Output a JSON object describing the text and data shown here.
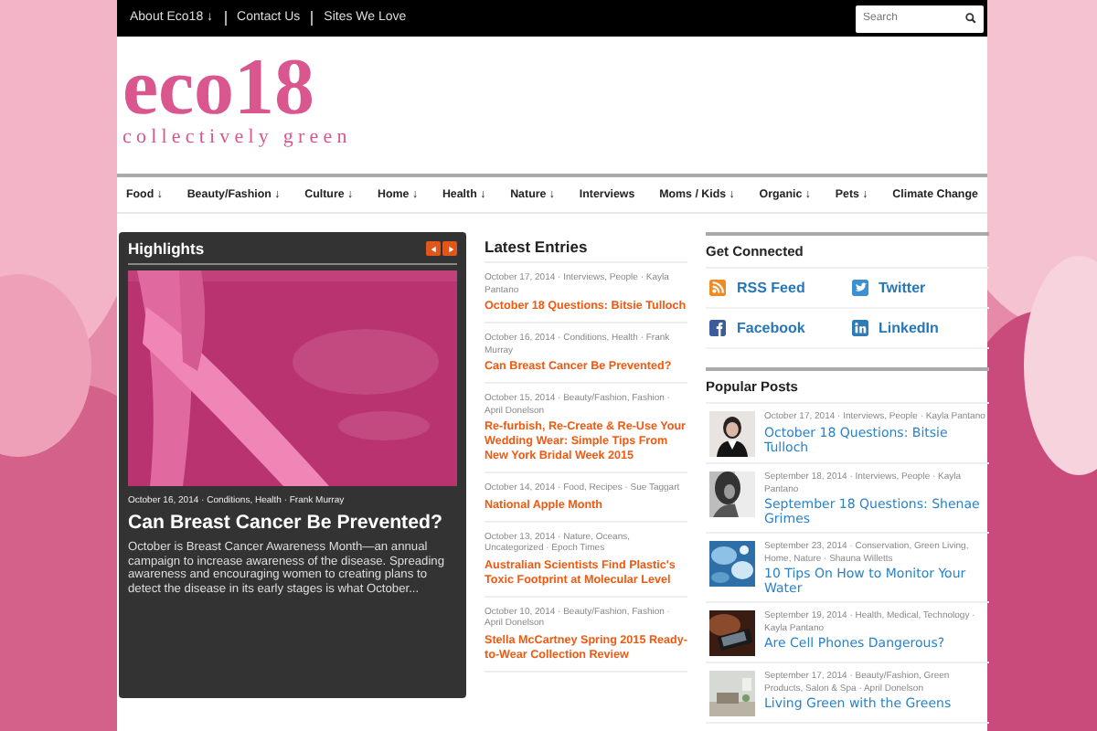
{
  "top_bar": {
    "links": [
      "About Eco18 ↓",
      "Contact Us",
      "Sites We Love"
    ],
    "search": {
      "placeholder": "Search"
    }
  },
  "logo": {
    "mark": "eco18",
    "tagline": "collectively green"
  },
  "nav": [
    "Food ↓",
    "Beauty/Fashion ↓",
    "Culture ↓",
    "Home ↓",
    "Health ↓",
    "Nature ↓",
    "Interviews",
    "Moms / Kids ↓",
    "Organic ↓",
    "Pets ↓",
    "Climate Change"
  ],
  "highlights": {
    "title": "Highlights",
    "meta": "October 16, 2014 · Conditions, Health · Frank Murray",
    "headline": "Can Breast Cancer Be Prevented?",
    "excerpt": "October is Breast Cancer Awareness Month—an annual campaign to increase awareness of the disease. Spreading awareness and encouraging women to creating plans to detect the disease in its early stages is what October..."
  },
  "latest_entries": {
    "title": "Latest Entries",
    "entries": [
      {
        "meta": "October 17, 2014 · Interviews, People · Kayla Pantano",
        "title": "October 18 Questions: Bitsie Tulloch"
      },
      {
        "meta": "October 16, 2014 · Conditions, Health · Frank Murray",
        "title": "Can Breast Cancer Be Prevented?"
      },
      {
        "meta": "October 15, 2014 · Beauty/Fashion, Fashion · April Donelson",
        "title": "Re-furbish, Re-Create & Re-Use Your Wedding Wear: Simple Tips From New York Bridal Week 2015"
      },
      {
        "meta": "October 14, 2014 · Food, Recipes · Sue Taggart",
        "title": "National Apple Month"
      },
      {
        "meta": "October 13, 2014 · Nature, Oceans, Uncategorized · Epoch Times",
        "title": "Australian Scientists Find Plastic's Toxic Footprint at Molecular Level"
      },
      {
        "meta": "October 10, 2014 · Beauty/Fashion, Fashion · April Donelson",
        "title": "Stella McCartney Spring 2015 Ready-to-Wear Collection Review"
      }
    ]
  },
  "get_connected": {
    "title": "Get Connected",
    "links": [
      {
        "kind": "rss",
        "label": "RSS Feed"
      },
      {
        "kind": "twitter",
        "label": "Twitter"
      },
      {
        "kind": "facebook",
        "label": "Facebook"
      },
      {
        "kind": "linkedin",
        "label": "LinkedIn"
      }
    ]
  },
  "popular_posts": {
    "title": "Popular Posts",
    "posts": [
      {
        "meta": "October 17, 2014 · Interviews, People · Kayla Pantano",
        "title": "October 18 Questions: Bitsie Tulloch"
      },
      {
        "meta": "September 18, 2014 · Interviews, People · Kayla Pantano",
        "title": "September 18 Questions: Shenae Grimes"
      },
      {
        "meta": "September 23, 2014 · Conservation, Green Living, Home, Nature · Shauna Willetts",
        "title": "10 Tips On How to Monitor Your Water"
      },
      {
        "meta": "September 19, 2014 · Health, Medical, Technology · Kayla Pantano",
        "title": "Are Cell Phones Dangerous?"
      },
      {
        "meta": "September 17, 2014 · Beauty/Fashion, Green Products, Salon & Spa · April Donelson",
        "title": "Living Green with the Greens"
      }
    ]
  }
}
